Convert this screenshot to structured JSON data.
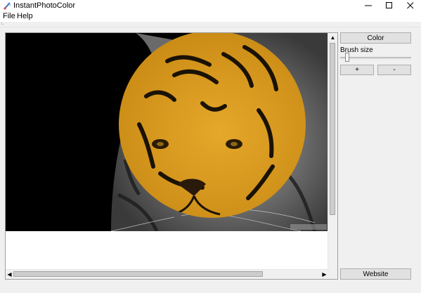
{
  "window": {
    "title": "InstantPhotoColor",
    "minimize_glyph": "—",
    "maximize_glyph": "☐",
    "close_glyph": "✕"
  },
  "menu": {
    "items": [
      {
        "label": "File"
      },
      {
        "label": "Help"
      }
    ]
  },
  "canvas": {
    "image_description_colors": {
      "background": "#000000",
      "colorized": "#e3a11f",
      "grayscale": "#8a8a8a"
    },
    "vertical_scroll_up": "▲",
    "horizontal_scroll_left": "◀",
    "horizontal_scroll_right": "▶"
  },
  "controls": {
    "color_button": "Color",
    "brush_size_label": "Brush size",
    "brush_size_value": 0.1,
    "plus_button": "+",
    "minus_button": "-",
    "website_button": "Website"
  },
  "icons": {
    "app": "paintbrush-icon",
    "grip": "toolstrip-grip-icon"
  }
}
